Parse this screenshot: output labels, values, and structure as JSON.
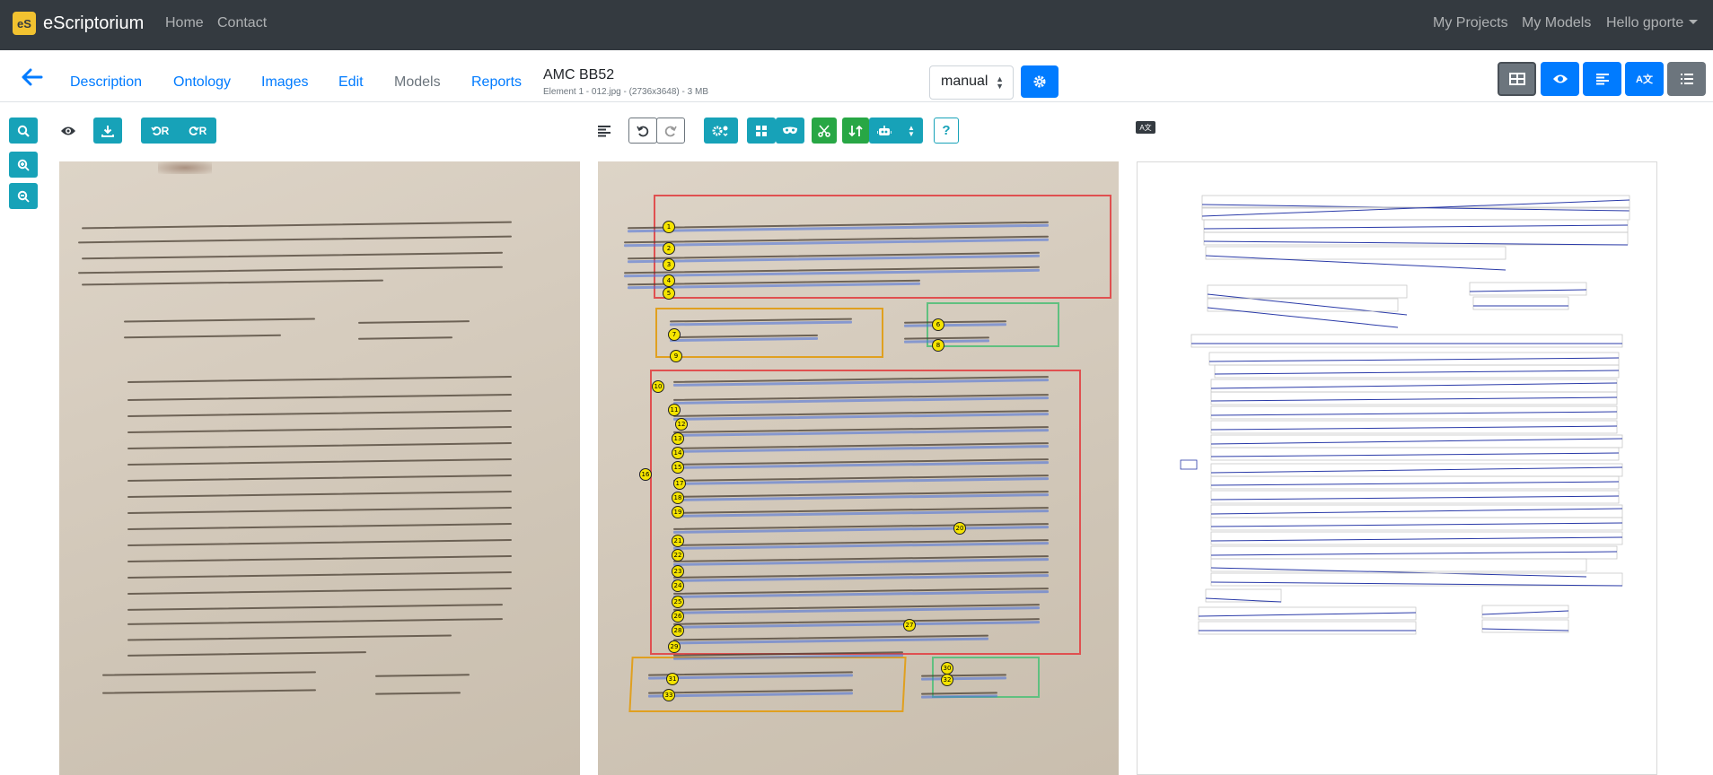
{
  "navbar": {
    "brand_logo": "eS",
    "brand": "eScriptorium",
    "home": "Home",
    "contact": "Contact",
    "my_projects": "My Projects",
    "my_models": "My Models",
    "user_greeting": "Hello gporte"
  },
  "tabs": {
    "description": "Description",
    "ontology": "Ontology",
    "images": "Images",
    "edit": "Edit",
    "models": "Models",
    "reports": "Reports"
  },
  "document": {
    "title": "AMC BB52",
    "subtitle": "Element 1 - 012.jpg - (2736x3648) - 3 MB"
  },
  "transcription_select": {
    "value": "manual"
  },
  "toolbar_labels": {
    "undo_r": "R",
    "redo_r": "R",
    "help": "?"
  },
  "translate_label": "A文",
  "seg_badges": [
    "1",
    "2",
    "3",
    "4",
    "5",
    "6",
    "7",
    "8",
    "9",
    "10",
    "11",
    "12",
    "13",
    "14",
    "15",
    "16",
    "17",
    "18",
    "19",
    "20",
    "21",
    "22",
    "23",
    "24",
    "25",
    "26",
    "27",
    "28",
    "29",
    "30",
    "31",
    "32",
    "33"
  ],
  "colors": {
    "navbar": "#343a40",
    "primary": "#007bff",
    "info": "#17a2b8",
    "success": "#28a745",
    "secondary": "#6c757d",
    "region_main": "#e05050",
    "region_orange": "#e0a020",
    "region_green": "#60c080"
  },
  "icons": {
    "back": "arrow-left-icon",
    "search": "search-icon",
    "zoom_in": "zoom-in-icon",
    "zoom_out": "zoom-out-icon",
    "eye": "eye-icon",
    "download": "download-icon",
    "align": "align-left-icon",
    "undo": "undo-icon",
    "redo": "redo-icon",
    "gear": "gear-icon"
  }
}
